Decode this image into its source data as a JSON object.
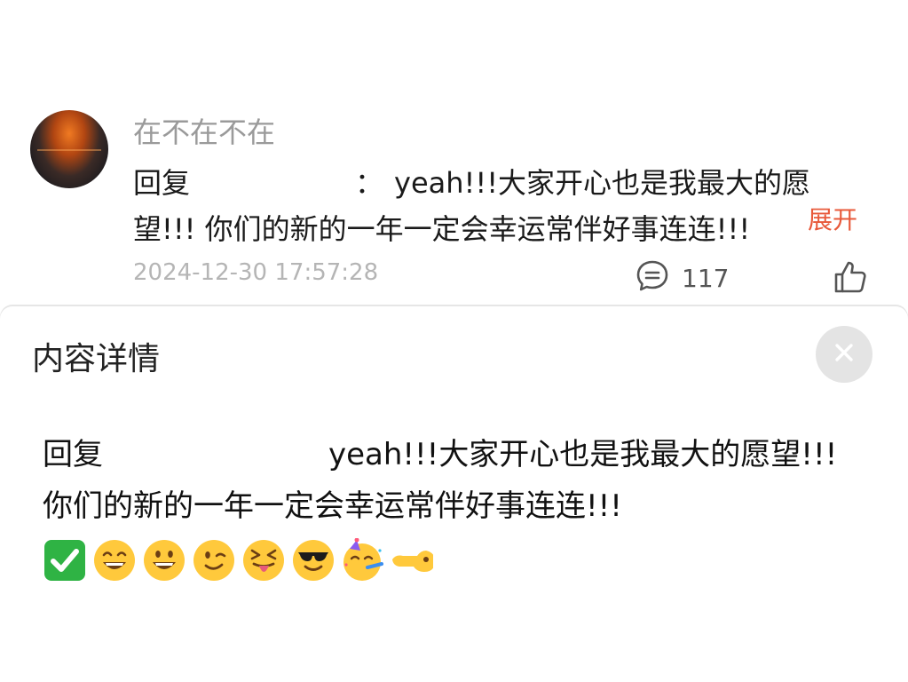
{
  "comment": {
    "username": "在不在不在",
    "reply_prefix": "回复",
    "reply_colon": "：",
    "reply_body": "yeah!!!大家开心也是我最大的愿望!!! 你们的新的一年一定会幸运常伴好事连连!!!",
    "expand_label": "展开",
    "timestamp": "2024-12-30 17:57:28",
    "reply_count": "117",
    "icons": {
      "reply": "speech-bubble-icon",
      "like": "thumbs-up-icon"
    }
  },
  "detail": {
    "title": "内容详情",
    "close_icon": "close-icon",
    "reply_prefix": "回复",
    "body": "yeah!!!大家开心也是我最大的愿望!!! 你们的新的一年一定会幸运常伴好事连连!!!",
    "emojis": [
      "white-check-mark",
      "grinning-face-with-smiling-eyes",
      "grinning-face",
      "winking-face",
      "squinting-tongue-face",
      "sunglasses-face",
      "partying-face",
      "pointing-hand"
    ]
  },
  "colors": {
    "accent": "#e8593a",
    "muted": "#9a9a9a",
    "timestamp": "#b5b5b5"
  }
}
